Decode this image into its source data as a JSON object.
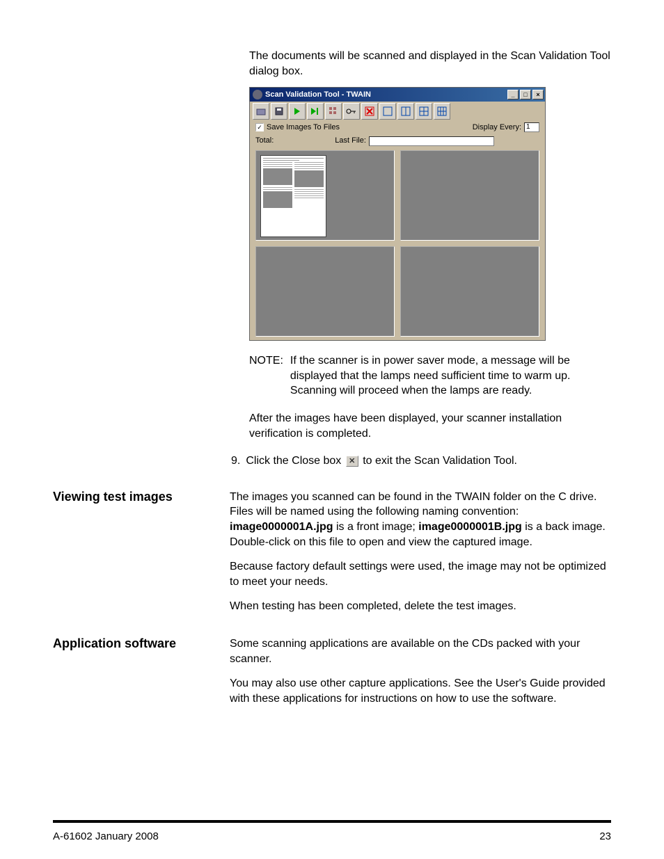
{
  "intro": "The documents will be scanned and displayed in the Scan Validation Tool dialog box.",
  "screenshot": {
    "title": "Scan Validation Tool - TWAIN",
    "window_buttons": {
      "min": "_",
      "max": "□",
      "close": "×"
    },
    "toolbar_icons": [
      "scanner-icon",
      "disk-icon",
      "play-icon",
      "play-end-icon",
      "settings-grid-icon",
      "key-icon",
      "clear-x-icon",
      "pane-one-icon",
      "pane-two-icon",
      "pane-four-icon",
      "pane-grid-icon"
    ],
    "save_label": "Save Images To Files",
    "save_checked": "✓",
    "display_every_label": "Display Every:",
    "display_every_value": "1",
    "total_label": "Total:",
    "lastfile_label": "Last File:"
  },
  "note_label": "NOTE:",
  "note_text": "If the scanner is in power saver mode, a message will be displayed that the lamps need sufficient time to warm up. Scanning will proceed when the lamps are ready.",
  "after_para": "After the images have been displayed, your scanner installation verification is completed.",
  "step_num": "9.",
  "step_pre": "Click the Close box",
  "step_post": "to exit the Scan Validation Tool.",
  "close_x": "✕",
  "sections": {
    "viewing": {
      "heading": "Viewing test images",
      "p1_pre": "The images you scanned can be found in the TWAIN folder on the C drive. Files will be named using the following naming convention: ",
      "p1_b1": "image0000001A.jpg",
      "p1_mid": " is a front image; ",
      "p1_b2": "image0000001B.jpg",
      "p1_post": " is a back image. Double-click on this file to open and view the captured image.",
      "p2": "Because factory default settings were used, the image may not be optimized to meet your needs.",
      "p3": "When testing has been completed, delete the test images."
    },
    "appsoft": {
      "heading": "Application software",
      "p1": "Some scanning applications are available on the CDs packed with your scanner.",
      "p2": "You may also use other capture applications. See the User's Guide provided with these applications for instructions on how to use the software."
    }
  },
  "footer": {
    "doc": "A-61602   January 2008",
    "page": "23"
  }
}
